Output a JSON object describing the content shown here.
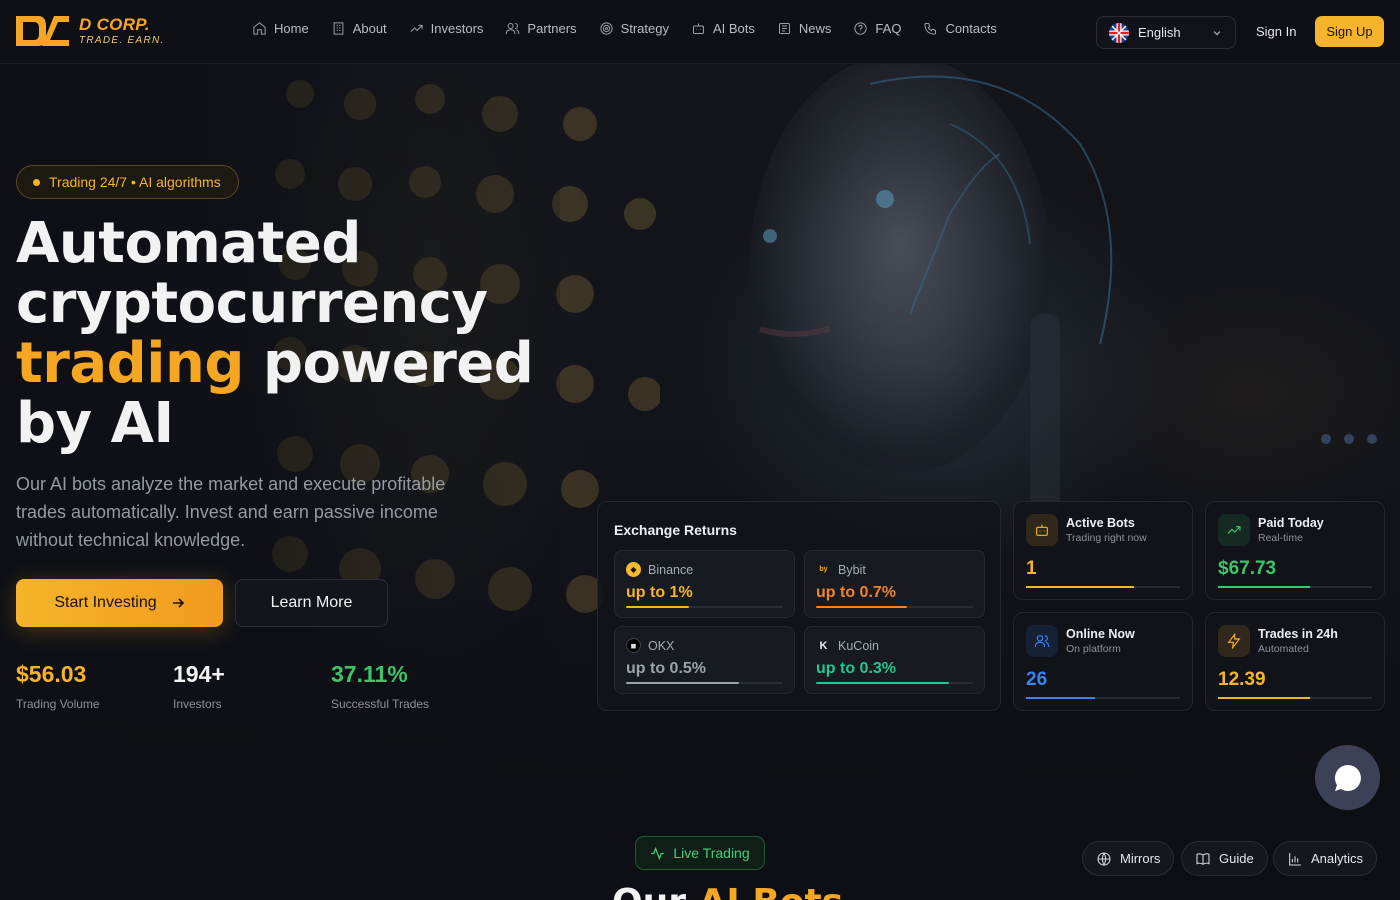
{
  "brand": {
    "name": "D CORP.",
    "tagline": "TRADE. EARN."
  },
  "nav": [
    {
      "label": "Home",
      "icon": "home-icon"
    },
    {
      "label": "About",
      "icon": "building-icon"
    },
    {
      "label": "Investors",
      "icon": "trending-up-icon"
    },
    {
      "label": "Partners",
      "icon": "users-icon"
    },
    {
      "label": "Strategy",
      "icon": "target-icon"
    },
    {
      "label": "AI Bots",
      "icon": "bot-icon"
    },
    {
      "label": "News",
      "icon": "newspaper-icon"
    },
    {
      "label": "FAQ",
      "icon": "help-circle-icon"
    },
    {
      "label": "Contacts",
      "icon": "phone-icon"
    }
  ],
  "header": {
    "language": "English",
    "sign_in": "Sign In",
    "sign_up": "Sign Up"
  },
  "hero": {
    "badge": "Trading 24/7 • AI algorithms",
    "title_line1": "Automated",
    "title_line2": "cryptocurrency",
    "title_accent": "trading",
    "title_line3_rest": " powered",
    "title_line4": "by AI",
    "lead": "Our AI bots analyze the market and execute profitable trades automatically. Invest and earn passive income without technical knowledge.",
    "primary_cta": "Start Investing",
    "secondary_cta": "Learn More"
  },
  "stats": [
    {
      "value": "$56.03",
      "label": "Trading Volume",
      "color": "#f5b42a"
    },
    {
      "value": "194+",
      "label": "Investors",
      "color": "#f2f2f3"
    },
    {
      "value": "37.11%",
      "label": "Successful Trades",
      "color": "#3fc46a"
    }
  ],
  "exchange_returns": {
    "title": "Exchange Returns",
    "items": [
      {
        "name": "Binance",
        "return": "up to 1%",
        "color": "#f5b42a",
        "progress": 0.4
      },
      {
        "name": "Bybit",
        "return": "up to 0.7%",
        "color": "#f0842d",
        "progress": 0.58
      },
      {
        "name": "OKX",
        "return": "up to 0.5%",
        "color": "#9ea2ab",
        "progress": 0.72
      },
      {
        "name": "KuCoin",
        "return": "up to 0.3%",
        "color": "#21c78f",
        "progress": 0.85
      }
    ]
  },
  "live_cards": [
    {
      "title": "Active Bots",
      "subtitle": "Trading right now",
      "value": "1",
      "color": "#f5b42a",
      "progress": 0.7,
      "icon": "bot-icon"
    },
    {
      "title": "Paid Today",
      "subtitle": "Real-time",
      "value": "$67.73",
      "color": "#3fc46a",
      "progress": 0.6,
      "icon": "trending-up-icon"
    },
    {
      "title": "Online Now",
      "subtitle": "On platform",
      "value": "26",
      "color": "#3b82f6",
      "progress": 0.45,
      "icon": "users-icon"
    },
    {
      "title": "Trades in 24h",
      "subtitle": "Automated",
      "value": "12.39",
      "color": "#f5b42a",
      "progress": 0.6,
      "icon": "zap-icon"
    }
  ],
  "next_section": {
    "badge": "Live Trading",
    "title_start": "Our ",
    "title_accent": "AI Bots"
  },
  "footer_buttons": [
    {
      "label": "Mirrors",
      "icon": "globe-icon"
    },
    {
      "label": "Guide",
      "icon": "book-icon"
    },
    {
      "label": "Analytics",
      "icon": "bar-chart-icon"
    }
  ]
}
